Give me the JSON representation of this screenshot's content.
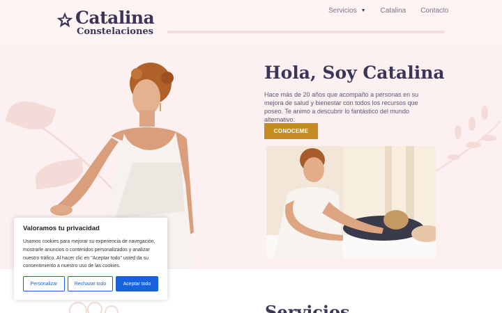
{
  "logo": {
    "title": "Catalina",
    "subtitle": "Constelaciones",
    "icon": "star-icon"
  },
  "nav": {
    "items": [
      {
        "label": "Servicios",
        "has_dropdown": true
      },
      {
        "label": "Catalina",
        "has_dropdown": false
      },
      {
        "label": "Contacto",
        "has_dropdown": false
      }
    ]
  },
  "hero": {
    "heading": "Hola, Soy Catalina",
    "intro": "Hace más de 20 años que acompaño a personas en su mejora de salud y bienestar con todos los recursos que poseo. Te animo a descubrir lo fantástico del mundo alternativo.",
    "cta_label": "CONOCEME"
  },
  "section": {
    "title": "Servicios"
  },
  "cookie": {
    "title": "Valoramos tu privacidad",
    "text": "Usamos cookies para mejorar su experiencia de navegación, mostrarle anuncios o contenidos personalizados y analizar nuestro tráfico. Al hacer clic en \"Aceptar todo\" usted da su consentimiento a nuestro uso de las cookies.",
    "customize_label": "Personalizar",
    "reject_label": "Rechazar todo",
    "accept_label": "Aceptar todo"
  },
  "colors": {
    "brand_dark": "#3b3558",
    "cta": "#c68c24",
    "cookie_blue": "#1863dc",
    "background": "#fcf1f0"
  }
}
